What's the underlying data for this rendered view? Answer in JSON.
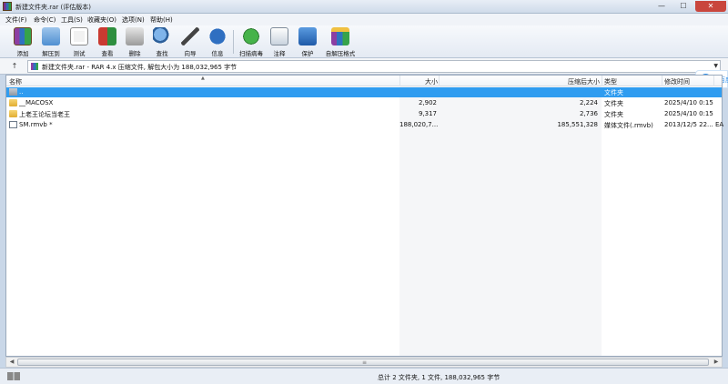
{
  "window": {
    "title": "新建文件夹.rar (评估版本)",
    "controls": {
      "minimize": "—",
      "maximize": "☐",
      "close": "✕"
    }
  },
  "menu": [
    {
      "label": "文件(F)"
    },
    {
      "label": "命令(C)"
    },
    {
      "label": "工具(S)"
    },
    {
      "label": "收藏夹(O)"
    },
    {
      "label": "选项(N)"
    },
    {
      "label": "帮助(H)"
    }
  ],
  "toolbar": [
    {
      "label": "添加",
      "icon": "add-icon"
    },
    {
      "label": "解压到",
      "icon": "extract-icon"
    },
    {
      "label": "测试",
      "icon": "test-icon"
    },
    {
      "label": "查看",
      "icon": "view-icon"
    },
    {
      "label": "删除",
      "icon": "delete-icon"
    },
    {
      "label": "查找",
      "icon": "find-icon"
    },
    {
      "label": "向导",
      "icon": "wizard-icon"
    },
    {
      "label": "信息",
      "icon": "info-icon"
    },
    {
      "label": "扫描病毒",
      "icon": "virus-scan-icon"
    },
    {
      "label": "注释",
      "icon": "comment-icon"
    },
    {
      "label": "保护",
      "icon": "protect-icon"
    },
    {
      "label": "自解压格式",
      "icon": "sfx-icon"
    }
  ],
  "address": {
    "path": "新建文件夹.rar - RAR 4.x 压缩文件, 解包大小为 188,032,965 字节",
    "up_glyph": "↑",
    "dropdown_glyph": "▼"
  },
  "side_widget": {
    "label": "百度",
    "icon": "cloud-icon"
  },
  "columns": {
    "name": "名称",
    "size": "大小",
    "packed": "压缩后大小",
    "type": "类型",
    "modified": "修改时间",
    "sort_glyph": "▲"
  },
  "rows": [
    {
      "name": "..",
      "size": "",
      "packed": "",
      "type": "文件夹",
      "modified": "",
      "extra": "",
      "kind": "parent",
      "selected": true
    },
    {
      "name": "__MACOSX",
      "size": "2,902",
      "packed": "2,224",
      "type": "文件夹",
      "modified": "2025/4/10 0:15",
      "extra": "",
      "kind": "folder",
      "selected": false
    },
    {
      "name": "上老王论坛当老王",
      "size": "9,317",
      "packed": "2,736",
      "type": "文件夹",
      "modified": "2025/4/10 0:15",
      "extra": "",
      "kind": "folder",
      "selected": false
    },
    {
      "name": "SM.rmvb *",
      "size": "188,020,7...",
      "packed": "185,551,328",
      "type": "媒体文件(.rmvb)",
      "modified": "2013/12/5 22...",
      "extra": "EA",
      "kind": "file",
      "selected": false
    }
  ],
  "scrollbar": {
    "left_glyph": "◀",
    "right_glyph": "▶",
    "grip_glyph": "≡"
  },
  "status": {
    "text": "总计 2 文件夹, 1 文件, 188,032,965 字节"
  },
  "colors": {
    "selection": "#2f9cf0",
    "accent": "#2b8ce8"
  }
}
